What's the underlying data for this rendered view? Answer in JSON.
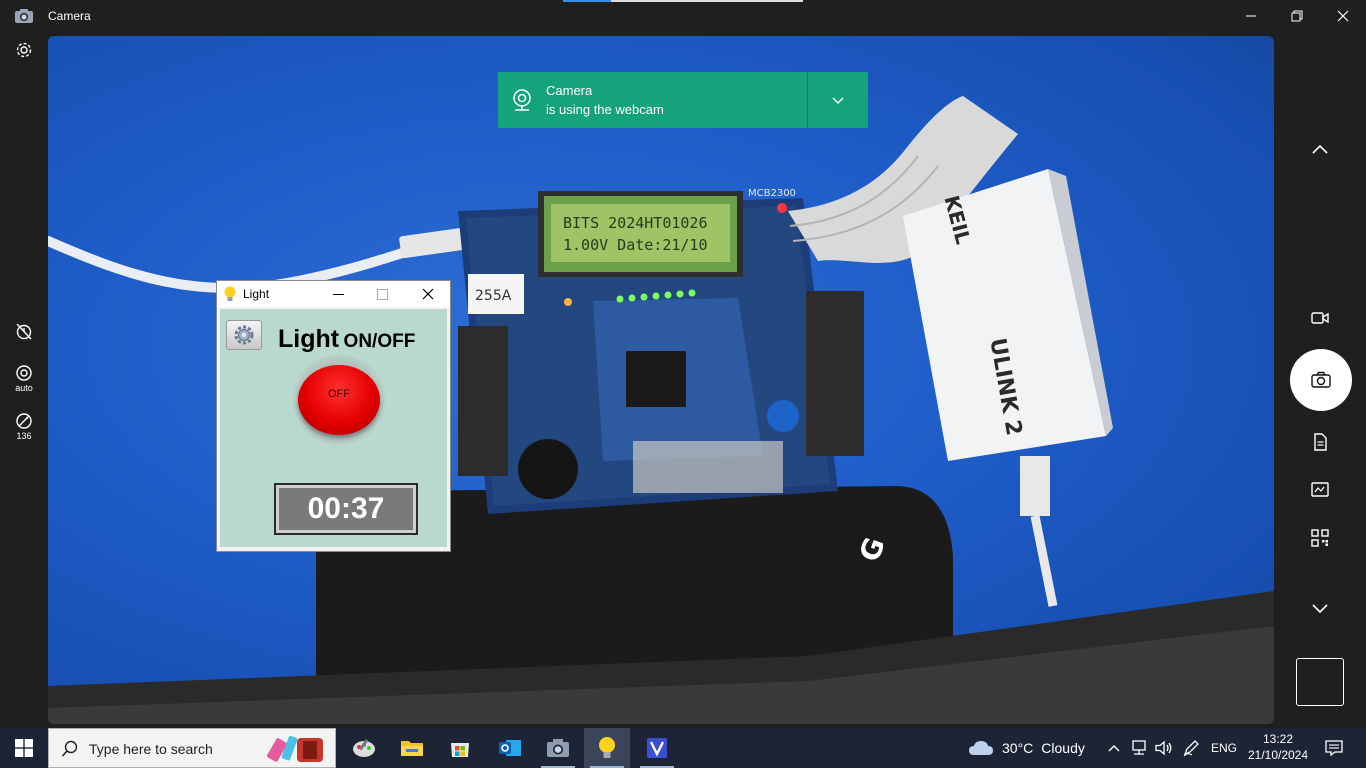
{
  "app": {
    "title": "Camera"
  },
  "left_panel": {
    "mode_label": "auto",
    "brightness_label": "136"
  },
  "toast": {
    "line1": "Camera",
    "line2": "is using the webcam"
  },
  "scene": {
    "lcd_line1": "BITS 2024HT01026",
    "lcd_line2": "1.00V Date:21/10",
    "board_model": "MCB2300",
    "label_tag": "255A",
    "debugger_brand": "KEIL",
    "debugger_model": "ULINK 2"
  },
  "light_window": {
    "title": "Light",
    "heading_main": "Light",
    "heading_sub": "ON/OFF",
    "button_label": "OFF",
    "timer": "00:37"
  },
  "taskbar": {
    "search_placeholder": "Type here to search",
    "weather_temp": "30°C",
    "weather_condition": "Cloudy",
    "language": "ENG",
    "time": "13:22",
    "date": "21/10/2024"
  },
  "colors": {
    "toast_bg": "#14a37a",
    "timer_bg": "#7a7a7a",
    "window_client": "#b9d8cf",
    "toggle_red": "#e40000",
    "taskbar_bg": "#1c2436"
  }
}
